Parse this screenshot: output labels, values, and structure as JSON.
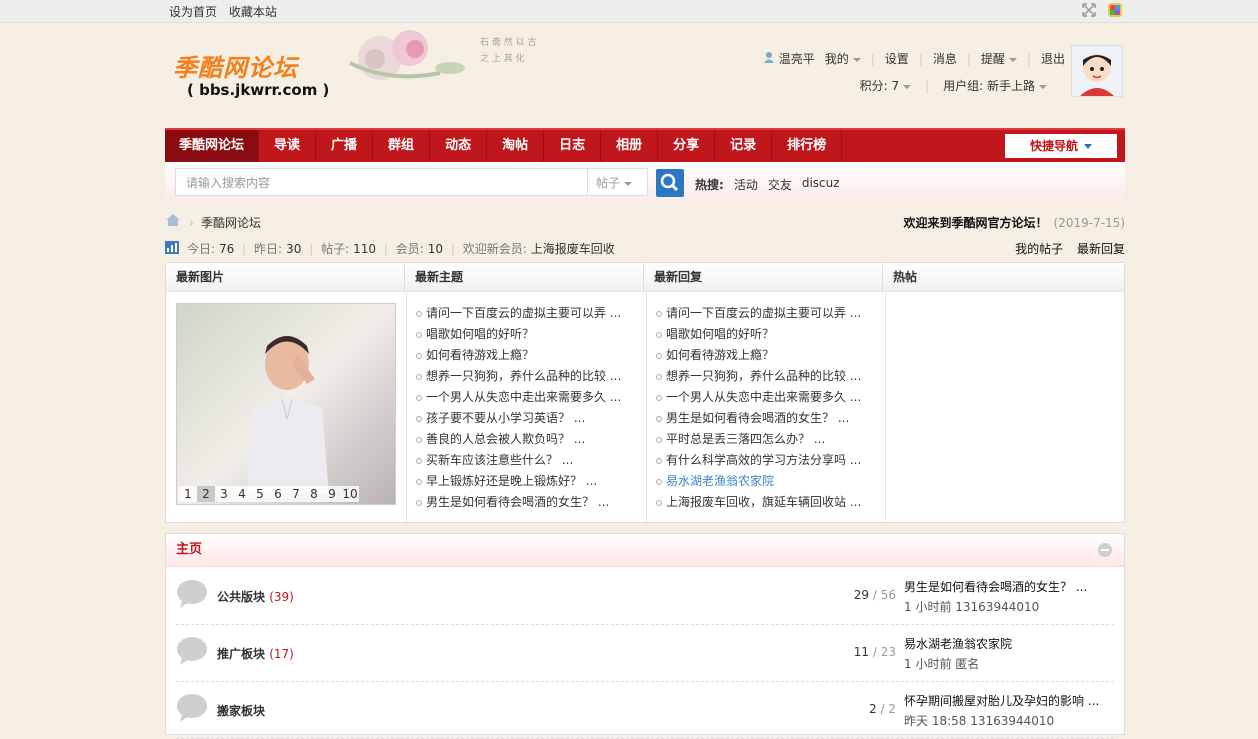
{
  "topbar": {
    "set_home": "设为首页",
    "bookmark": "收藏本站"
  },
  "header": {
    "logo_title": "季酷网论坛",
    "logo_url": "( bbs.jkwrr.com )",
    "user": {
      "username": "温亮平",
      "mine": "我的",
      "settings": "设置",
      "messages": "消息",
      "remind": "提醒",
      "logout": "退出",
      "points": "积分: 7",
      "group": "用户组: 新手上路"
    }
  },
  "nav": {
    "items": [
      "季酷网论坛",
      "导读",
      "广播",
      "群组",
      "动态",
      "淘帖",
      "日志",
      "相册",
      "分享",
      "记录",
      "排行榜"
    ],
    "quick": "快捷导航"
  },
  "search": {
    "placeholder": "请输入搜索内容",
    "type": "帖子",
    "hot_label": "热搜:",
    "hot": [
      "活动",
      "交友",
      "discuz"
    ]
  },
  "crumb": {
    "path": "季酷网论坛",
    "welcome": "欢迎来到季酷网官方论坛！",
    "date": "(2019-7-15)"
  },
  "stats": {
    "today_label": "今日:",
    "today": "76",
    "yesterday_label": "昨日:",
    "yesterday": "30",
    "posts_label": "帖子:",
    "posts": "110",
    "members_label": "会员:",
    "members": "10",
    "newest_label": "欢迎新会员:",
    "newest": "上海报废车回收",
    "my_posts": "我的帖子",
    "latest_replies": "最新回复"
  },
  "panel": {
    "headers": [
      "最新图片",
      "最新主题",
      "最新回复",
      "热帖"
    ],
    "pic_nums": [
      "1",
      "2",
      "3",
      "4",
      "5",
      "6",
      "7",
      "8",
      "9",
      "10"
    ],
    "topics": [
      "请问一下百度云的虚拟主要可以弄 ...",
      "唱歌如何唱的好听？",
      "如何看待游戏上瘾？",
      "想养一只狗狗，养什么品种的比较 ...",
      "一个男人从失恋中走出来需要多久 ...",
      "孩子要不要从小学习英语？ ...",
      "善良的人总会被人欺负吗？ ...",
      "买新车应该注意些什么？ ...",
      "早上锻炼好还是晚上锻炼好？ ...",
      "男生是如何看待会喝酒的女生？ ..."
    ],
    "replies": [
      "请问一下百度云的虚拟主要可以弄 ...",
      "唱歌如何唱的好听？",
      "如何看待游戏上瘾？",
      "想养一只狗狗，养什么品种的比较 ...",
      "一个男人从失恋中走出来需要多久 ...",
      "男生是如何看待会喝酒的女生？ ...",
      "平时总是丢三落四怎么办？ ...",
      "有什么科学高效的学习方法分享吗 ...",
      "易水湖老渔翁农家院",
      "上海报废车回收，旗延车辆回收站 ..."
    ]
  },
  "main": {
    "title": "主页",
    "forums": [
      {
        "name": "公共版块",
        "count": "(39)",
        "threads": "29",
        "posts": "56",
        "last_title": "男生是如何看待会喝酒的女生？ ...",
        "last_meta": "1 小时前 13163944010"
      },
      {
        "name": "推广板块",
        "count": "(17)",
        "threads": "11",
        "posts": "23",
        "last_title": "易水湖老渔翁农家院",
        "last_meta": "1 小时前 匿名"
      },
      {
        "name": "搬家板块",
        "count": "",
        "threads": "2",
        "posts": "2",
        "last_title": "怀孕期间搬屋对胎儿及孕妇的影响 ...",
        "last_meta": "昨天 18:58 13163944010"
      }
    ]
  }
}
